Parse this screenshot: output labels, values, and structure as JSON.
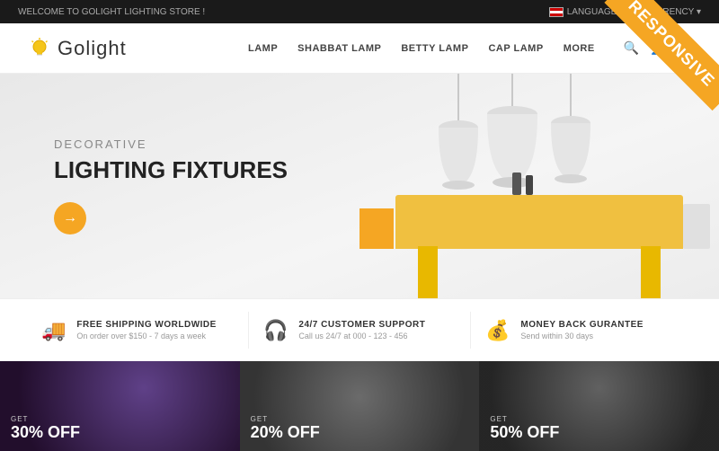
{
  "topbar": {
    "welcome_text": "WELCOME TO GOLIGHT LIGHTING STORE !",
    "language_label": "LANGUAGE",
    "currency_label": "$ CURRENCY"
  },
  "header": {
    "logo_text": "Golight",
    "nav_items": [
      {
        "label": "LAMP",
        "id": "lamp"
      },
      {
        "label": "SHABBAT LAMP",
        "id": "shabbat-lamp"
      },
      {
        "label": "BETTY LAMP",
        "id": "betty-lamp"
      },
      {
        "label": "CAP LAMP",
        "id": "cap-lamp"
      },
      {
        "label": "MORE",
        "id": "more"
      }
    ]
  },
  "hero": {
    "subtitle": "DECORATIVE",
    "title": "LIGHTING FIXTURES",
    "cta_label": "→"
  },
  "features": [
    {
      "icon": "🚚",
      "title": "FREE SHIPPING WORLDWIDE",
      "desc": "On order over $150 - 7 days a week"
    },
    {
      "icon": "🎧",
      "title": "24/7 CUSTOMER SUPPORT",
      "desc": "Call us 24/7 at 000 - 123 - 456"
    },
    {
      "icon": "💰",
      "title": "MONEY BACK GURANTEE",
      "desc": "Send within 30 days"
    }
  ],
  "products": [
    {
      "get": "GET",
      "discount": "30% OFF",
      "color": "#1a1a2e"
    },
    {
      "get": "GET",
      "discount": "20% OFF",
      "color": "#2d2d2d"
    },
    {
      "get": "GET",
      "discount": "50% OFF",
      "color": "#1a1a1a"
    }
  ],
  "badge": {
    "label": "RESPONSIVE"
  }
}
